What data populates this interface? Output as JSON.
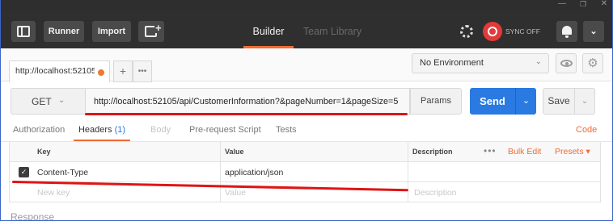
{
  "window": {
    "minimize": "—",
    "maximize": "❐",
    "close": "✕"
  },
  "header": {
    "runner_label": "Runner",
    "import_label": "Import",
    "builder_tab": "Builder",
    "team_library_tab": "Team Library",
    "sync_label": "SYNC OFF",
    "menu_chevron": "⌄"
  },
  "request_tab": {
    "title": "http://localhost:52105",
    "add_symbol": "+",
    "more_symbol": "•••"
  },
  "environment": {
    "selected": "No Environment",
    "chevron": "⌄"
  },
  "request": {
    "method": "GET",
    "method_chevron": "⌄",
    "url": "http://localhost:52105/api/CustomerInformation?&pageNumber=1&pageSize=5",
    "params_label": "Params",
    "send_label": "Send",
    "send_chevron": "⌄",
    "save_label": "Save",
    "save_chevron": "⌄"
  },
  "subtabs": {
    "authorization": "Authorization",
    "headers": "Headers",
    "headers_count": "(1)",
    "body": "Body",
    "prerequest": "Pre-request Script",
    "tests": "Tests",
    "code": "Code"
  },
  "headers_table": {
    "columns": {
      "key": "Key",
      "value": "Value",
      "description": "Description"
    },
    "more_symbol": "•••",
    "bulk_edit": "Bulk Edit",
    "presets": "Presets ▾",
    "rows": [
      {
        "checked": true,
        "check_glyph": "✓",
        "key": "Content-Type",
        "value": "application/json",
        "description": ""
      }
    ],
    "new_row": {
      "key_placeholder": "New key",
      "value_placeholder": "Value",
      "description_placeholder": "Description"
    }
  },
  "response": {
    "label": "Response"
  },
  "colors": {
    "accent_orange": "#ef6c34",
    "send_blue": "#2a7ae2",
    "sync_red": "#e23a3a",
    "annotation_red": "#e01414",
    "header_dark": "#2f2f2f"
  },
  "icons": {
    "sidebar_toggle": "sidebar-icon",
    "new_window": "new-window-icon",
    "interceptor": "interceptor-icon",
    "sync": "sync-icon",
    "notifications": "bell-icon",
    "environment_quick_look": "eye-icon",
    "settings": "gear-icon"
  }
}
